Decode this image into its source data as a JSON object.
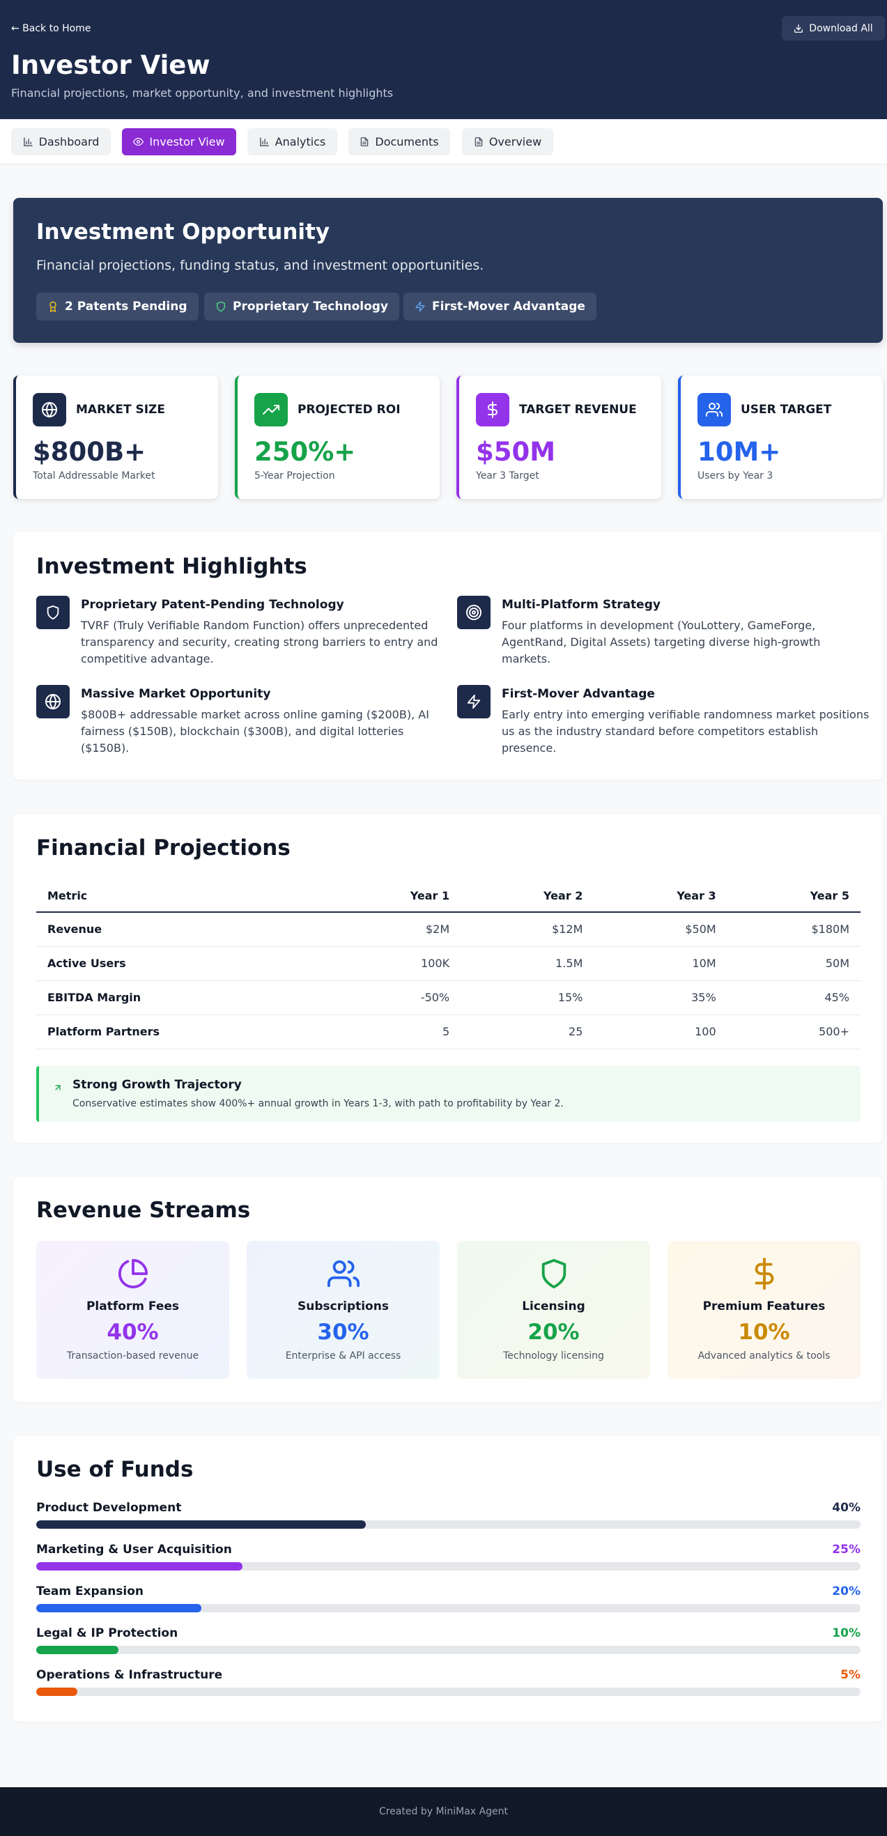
{
  "header": {
    "back_label": "← Back to Home",
    "download_label": "Download All",
    "title": "Investor View",
    "subtitle": "Financial projections, market opportunity, and investment highlights"
  },
  "tabs": [
    {
      "label": "Dashboard",
      "icon": "bar-chart-icon",
      "active": false
    },
    {
      "label": "Investor View",
      "icon": "eye-icon",
      "active": true
    },
    {
      "label": "Analytics",
      "icon": "bar-chart-icon",
      "active": false
    },
    {
      "label": "Documents",
      "icon": "file-icon",
      "active": false
    },
    {
      "label": "Overview",
      "icon": "file-icon",
      "active": false
    }
  ],
  "hero": {
    "title": "Investment Opportunity",
    "subtitle": "Financial projections, funding status, and investment opportunities.",
    "pills": [
      {
        "label": "2 Patents Pending",
        "icon": "award-icon"
      },
      {
        "label": "Proprietary Technology",
        "icon": "shield-icon"
      },
      {
        "label": "First-Mover Advantage",
        "icon": "zap-icon"
      }
    ]
  },
  "metrics": [
    {
      "label": "MARKET SIZE",
      "value": "$800B+",
      "desc": "Total Addressable Market",
      "icon": "globe-icon",
      "color": "#1e2a4a"
    },
    {
      "label": "PROJECTED ROI",
      "value": "250%+",
      "desc": "5-Year Projection",
      "icon": "trending-up-icon",
      "color": "#16a34a"
    },
    {
      "label": "TARGET REVENUE",
      "value": "$50M",
      "desc": "Year 3 Target",
      "icon": "dollar-icon",
      "color": "#9333ea"
    },
    {
      "label": "USER TARGET",
      "value": "10M+",
      "desc": "Users by Year 3",
      "icon": "users-icon",
      "color": "#2563eb"
    }
  ],
  "highlights": {
    "title": "Investment Highlights",
    "items": [
      {
        "title": "Proprietary Patent-Pending Technology",
        "text": "TVRF (Truly Verifiable Random Function) offers unprecedented transparency and security, creating strong barriers to entry and competitive advantage.",
        "icon": "shield-icon"
      },
      {
        "title": "Multi-Platform Strategy",
        "text": "Four platforms in development (YouLottery, GameForge, AgentRand, Digital Assets) targeting diverse high-growth markets.",
        "icon": "target-icon"
      },
      {
        "title": "Massive Market Opportunity",
        "text": "$800B+ addressable market across online gaming ($200B), AI fairness ($150B), blockchain ($300B), and digital lotteries ($150B).",
        "icon": "globe-icon"
      },
      {
        "title": "First-Mover Advantage",
        "text": "Early entry into emerging verifiable randomness market positions us as the industry standard before competitors establish presence.",
        "icon": "zap-icon"
      }
    ]
  },
  "financials": {
    "title": "Financial Projections",
    "columns": [
      "Metric",
      "Year 1",
      "Year 2",
      "Year 3",
      "Year 5"
    ],
    "rows": [
      [
        "Revenue",
        "$2M",
        "$12M",
        "$50M",
        "$180M"
      ],
      [
        "Active Users",
        "100K",
        "1.5M",
        "10M",
        "50M"
      ],
      [
        "EBITDA Margin",
        "-50%",
        "15%",
        "35%",
        "45%"
      ],
      [
        "Platform Partners",
        "5",
        "25",
        "100",
        "500+"
      ]
    ],
    "callout_title": "Strong Growth Trajectory",
    "callout_text": "Conservative estimates show 400%+ annual growth in Years 1-3, with path to profitability by Year 2."
  },
  "revenue": {
    "title": "Revenue Streams",
    "items": [
      {
        "name": "Platform Fees",
        "pct": "40%",
        "desc": "Transaction-based revenue",
        "icon": "pie-chart-icon",
        "color": "#9333ea",
        "bg": "#f4f0fd"
      },
      {
        "name": "Subscriptions",
        "pct": "30%",
        "desc": "Enterprise & API access",
        "icon": "users-icon",
        "color": "#2563eb",
        "bg": "#eef4fd"
      },
      {
        "name": "Licensing",
        "pct": "20%",
        "desc": "Technology licensing",
        "icon": "shield-icon",
        "color": "#16a34a",
        "bg": "#f1f9ef"
      },
      {
        "name": "Premium Features",
        "pct": "10%",
        "desc": "Advanced analytics & tools",
        "icon": "dollar-icon",
        "color": "#ca8a04",
        "bg": "#fdf8ec"
      }
    ]
  },
  "funds": {
    "title": "Use of Funds",
    "items": [
      {
        "label": "Product Development",
        "pct": "40%",
        "fraction": 0.4,
        "color": "#1e2a4a"
      },
      {
        "label": "Marketing & User Acquisition",
        "pct": "25%",
        "fraction": 0.25,
        "color": "#9333ea"
      },
      {
        "label": "Team Expansion",
        "pct": "20%",
        "fraction": 0.2,
        "color": "#2563eb"
      },
      {
        "label": "Legal & IP Protection",
        "pct": "10%",
        "fraction": 0.1,
        "color": "#16a34a"
      },
      {
        "label": "Operations & Infrastructure",
        "pct": "5%",
        "fraction": 0.05,
        "color": "#ea580c"
      }
    ]
  },
  "footer": {
    "text": "Created by MiniMax Agent"
  }
}
